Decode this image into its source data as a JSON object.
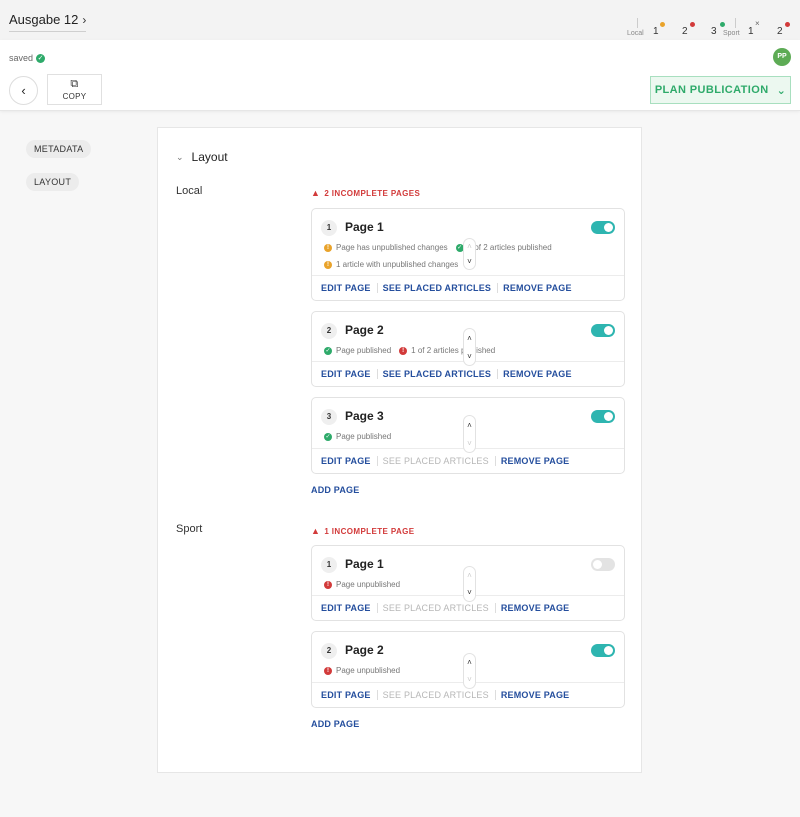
{
  "topbar": {
    "issue_title": "Ausgabe 12",
    "indicators": [
      {
        "num": "1",
        "dot": "#e9a32b",
        "group": "Local"
      },
      {
        "num": "2",
        "dot": "#d23a3a"
      },
      {
        "num": "3",
        "dot": "#2eaa6a"
      },
      {
        "num": "1",
        "mark": "×",
        "group": "Sport"
      },
      {
        "num": "2",
        "dot": "#d23a3a"
      }
    ],
    "group_labels": {
      "local": "Local",
      "sport": "Sport"
    }
  },
  "header": {
    "saved_label": "saved",
    "avatar_initials": "PP",
    "copy_label": "COPY",
    "plan_label": "PLAN PUBLICATION"
  },
  "sidebar": {
    "items": [
      {
        "label": "METADATA"
      },
      {
        "label": "LAYOUT"
      }
    ]
  },
  "panel": {
    "title": "Layout",
    "groups": [
      {
        "name": "Local",
        "incomplete": "2 INCOMPLETE PAGES",
        "add_page": "ADD PAGE",
        "pages": [
          {
            "num": "1",
            "title": "Page 1",
            "enabled": true,
            "status_1a": "Page has unpublished changes",
            "status_1b": "2 of 2 articles published",
            "status_2a": "1 article with unpublished changes",
            "actions": {
              "edit": "EDIT PAGE",
              "placed": "SEE PLACED ARTICLES",
              "remove": "REMOVE PAGE"
            }
          },
          {
            "num": "2",
            "title": "Page 2",
            "enabled": true,
            "status_1a": "Page published",
            "status_1b": "1 of 2 articles published",
            "actions": {
              "edit": "EDIT PAGE",
              "placed": "SEE PLACED ARTICLES",
              "remove": "REMOVE PAGE"
            }
          },
          {
            "num": "3",
            "title": "Page 3",
            "enabled": true,
            "status_1a": "Page published",
            "actions": {
              "edit": "EDIT PAGE",
              "placed": "SEE PLACED ARTICLES",
              "remove": "REMOVE PAGE"
            }
          }
        ]
      },
      {
        "name": "Sport",
        "incomplete": "1 INCOMPLETE PAGE",
        "add_page": "ADD PAGE",
        "pages": [
          {
            "num": "1",
            "title": "Page 1",
            "enabled": false,
            "status_1a": "Page unpublished",
            "actions": {
              "edit": "EDIT PAGE",
              "placed": "SEE PLACED ARTICLES",
              "remove": "REMOVE PAGE"
            }
          },
          {
            "num": "2",
            "title": "Page 2",
            "enabled": true,
            "status_1a": "Page unpublished",
            "actions": {
              "edit": "EDIT PAGE",
              "placed": "SEE PLACED ARTICLES",
              "remove": "REMOVE PAGE"
            }
          }
        ]
      }
    ]
  },
  "colors": {
    "accent_green": "#2eaa6a",
    "toggle_teal": "#2eb5b0",
    "link_blue": "#244e9d",
    "error_red": "#d23a3a",
    "warning_orange": "#e9a32b"
  }
}
